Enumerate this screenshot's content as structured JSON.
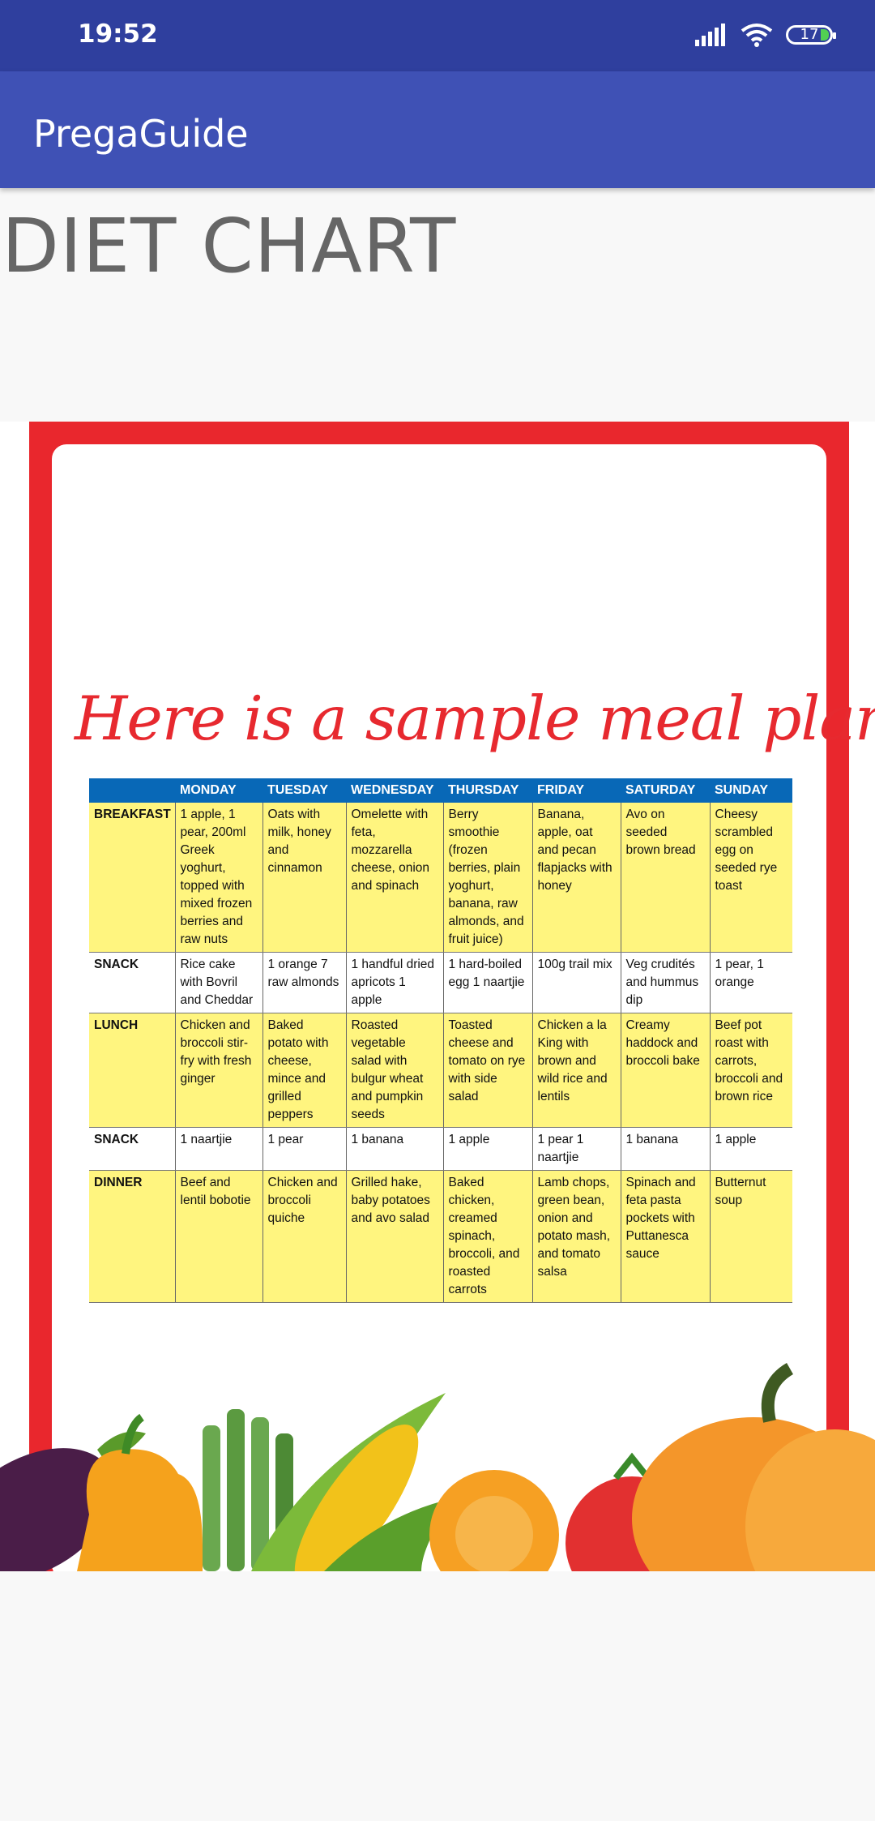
{
  "status_bar": {
    "time": "19:52",
    "battery": "17"
  },
  "app_bar": {
    "title": "PregaGuide"
  },
  "page": {
    "title": "DIET CHART"
  },
  "poster": {
    "heading": "Here is a sample meal plan to try:",
    "days": [
      "MONDAY",
      "TUESDAY",
      "WEDNESDAY",
      "THURSDAY",
      "FRIDAY",
      "SATURDAY",
      "SUNDAY"
    ],
    "rows": [
      {
        "label": "BREAKFAST",
        "cells": [
          "1 apple, 1 pear, 200ml Greek yoghurt, topped with mixed frozen berries and raw nuts",
          "Oats with milk, honey and cinnamon",
          "Omelette with feta, mozzarella cheese, onion and spinach",
          "Berry smoothie (frozen berries, plain yoghurt, banana, raw almonds, and fruit juice)",
          "Banana, apple, oat and pecan flapjacks with honey",
          "Avo on seeded brown bread",
          "Cheesy scrambled egg on seeded rye toast"
        ]
      },
      {
        "label": "SNACK",
        "cells": [
          "Rice cake with Bovril and Cheddar",
          "1 orange 7 raw almonds",
          "1 handful dried apricots 1 apple",
          "1 hard-boiled egg 1 naartjie",
          "100g trail mix",
          "Veg crudités and hummus dip",
          "1 pear, 1 orange"
        ]
      },
      {
        "label": "LUNCH",
        "cells": [
          "Chicken and broccoli stir-fry with fresh ginger",
          "Baked potato with cheese, mince and grilled peppers",
          "Roasted vegetable salad with bulgur wheat and pumpkin seeds",
          "Toasted cheese and tomato on rye with side salad",
          "Chicken a la King with brown and wild rice and lentils",
          "Creamy haddock and broccoli bake",
          "Beef pot roast with carrots, broccoli and brown rice"
        ]
      },
      {
        "label": "SNACK",
        "cells": [
          "1 naartjie",
          "1 pear",
          "1 banana",
          "1 apple",
          "1 pear 1 naartjie",
          "1 banana",
          "1 apple"
        ]
      },
      {
        "label": "DINNER",
        "cells": [
          "Beef and lentil bobotie",
          "Chicken and broccoli quiche",
          "Grilled hake, baby potatoes and avo salad",
          "Baked chicken, creamed spinach, broccoli, and roasted carrots",
          "Lamb chops, green bean, onion and potato mash, and tomato salsa",
          "Spinach and feta pasta pockets with Puttanesca sauce",
          "Butternut soup"
        ]
      }
    ]
  },
  "colors": {
    "status_bar": "#2f3f9e",
    "app_bar": "#3f51b5",
    "frame": "#e9272d",
    "table_header": "#0868b7",
    "shaded_row": "#fff57f"
  },
  "icons": [
    "signal-icon",
    "wifi-icon",
    "battery-icon"
  ]
}
